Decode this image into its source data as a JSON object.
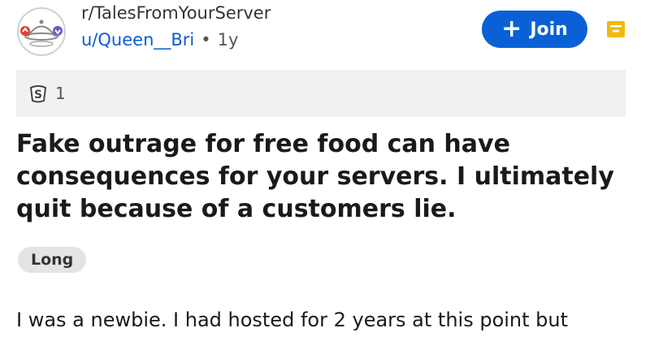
{
  "subreddit": "r/TalesFromYourServer",
  "author": {
    "username": "u/Queen__Bri",
    "separator": "•",
    "age": "1y"
  },
  "join_button": {
    "plus": "+",
    "label": "Join"
  },
  "awards": {
    "count": "1"
  },
  "post": {
    "title": "Fake outrage for free food can have consequences for your servers. I ultimately quit because of a customers lie.",
    "flair": "Long",
    "body_preview": "I was a newbie. I had hosted for 2 years at this point but"
  },
  "colors": {
    "accent": "#0a61d6",
    "username": "#0a5bd6",
    "menu_icon": "#f2b90d",
    "award_bar": "#f1f1f1",
    "flair_bg": "#e4e4e4"
  },
  "icons": {
    "avatar": "subreddit-avatar-icon",
    "menu": "menu-icon",
    "award": "award-icon"
  }
}
